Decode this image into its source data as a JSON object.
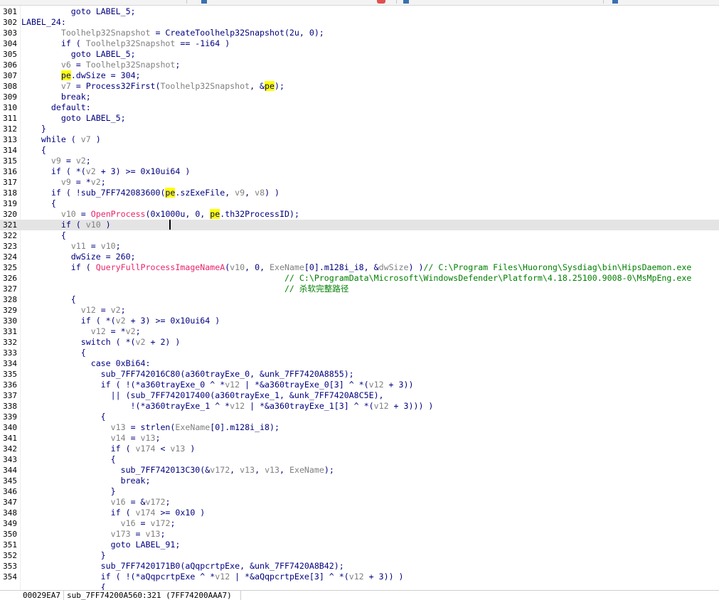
{
  "colors": {
    "text": "#000080",
    "variable": "#808080",
    "function": "#e8246b",
    "comment": "#008000",
    "highlight": "#ffff00",
    "current_line": "#e4e4e4"
  },
  "editor": {
    "current_line_number": "321",
    "lines": [
      {
        "n": "301",
        "segs": [
          [
            "t",
            "          goto LABEL_5;"
          ]
        ]
      },
      {
        "n": "302",
        "segs": [
          [
            "t",
            "LABEL_24:"
          ]
        ]
      },
      {
        "n": "303",
        "segs": [
          [
            "t",
            "        "
          ],
          [
            "v",
            "Toolhelp32Snapshot"
          ],
          [
            "t",
            " = CreateToolhelp32Snapshot(2u, 0);"
          ]
        ]
      },
      {
        "n": "304",
        "segs": [
          [
            "t",
            "        if ( "
          ],
          [
            "v",
            "Toolhelp32Snapshot"
          ],
          [
            "t",
            " == -1i64 )"
          ]
        ]
      },
      {
        "n": "305",
        "segs": [
          [
            "t",
            "          goto LABEL_5;"
          ]
        ]
      },
      {
        "n": "306",
        "segs": [
          [
            "t",
            "        "
          ],
          [
            "v",
            "v6"
          ],
          [
            "t",
            " = "
          ],
          [
            "v",
            "Toolhelp32Snapshot"
          ],
          [
            "t",
            ";"
          ]
        ]
      },
      {
        "n": "307",
        "segs": [
          [
            "t",
            "        "
          ],
          [
            "h",
            "pe"
          ],
          [
            "t",
            ".dwSize = 304;"
          ]
        ]
      },
      {
        "n": "308",
        "segs": [
          [
            "t",
            "        "
          ],
          [
            "v",
            "v7"
          ],
          [
            "t",
            " = Process32First("
          ],
          [
            "v",
            "Toolhelp32Snapshot"
          ],
          [
            "t",
            ", &"
          ],
          [
            "h",
            "pe"
          ],
          [
            "t",
            ");"
          ]
        ]
      },
      {
        "n": "309",
        "segs": [
          [
            "t",
            "        break;"
          ]
        ]
      },
      {
        "n": "310",
        "segs": [
          [
            "t",
            "      default:"
          ]
        ]
      },
      {
        "n": "311",
        "segs": [
          [
            "t",
            "        goto LABEL_5;"
          ]
        ]
      },
      {
        "n": "312",
        "segs": [
          [
            "t",
            "    }"
          ]
        ]
      },
      {
        "n": "313",
        "segs": [
          [
            "t",
            "    while ( "
          ],
          [
            "v",
            "v7"
          ],
          [
            "t",
            " )"
          ]
        ]
      },
      {
        "n": "314",
        "segs": [
          [
            "t",
            "    {"
          ]
        ]
      },
      {
        "n": "315",
        "segs": [
          [
            "t",
            "      "
          ],
          [
            "v",
            "v9"
          ],
          [
            "t",
            " = "
          ],
          [
            "v",
            "v2"
          ],
          [
            "t",
            ";"
          ]
        ]
      },
      {
        "n": "316",
        "segs": [
          [
            "t",
            "      if ( *("
          ],
          [
            "v",
            "v2"
          ],
          [
            "t",
            " + 3) >= 0x10ui64 )"
          ]
        ]
      },
      {
        "n": "317",
        "segs": [
          [
            "t",
            "        "
          ],
          [
            "v",
            "v9"
          ],
          [
            "t",
            " = *"
          ],
          [
            "v",
            "v2"
          ],
          [
            "t",
            ";"
          ]
        ]
      },
      {
        "n": "318",
        "segs": [
          [
            "t",
            "      if ( !sub_7FF742083600("
          ],
          [
            "h",
            "pe"
          ],
          [
            "t",
            ".szExeFile, "
          ],
          [
            "v",
            "v9"
          ],
          [
            "t",
            ", "
          ],
          [
            "v",
            "v8"
          ],
          [
            "t",
            ") )"
          ]
        ]
      },
      {
        "n": "319",
        "segs": [
          [
            "t",
            "      {"
          ]
        ]
      },
      {
        "n": "320",
        "segs": [
          [
            "t",
            "        "
          ],
          [
            "v",
            "v10"
          ],
          [
            "t",
            " = "
          ],
          [
            "f",
            "OpenProcess"
          ],
          [
            "t",
            "(0x1000u, 0, "
          ],
          [
            "h",
            "pe"
          ],
          [
            "t",
            ".th32ProcessID);"
          ]
        ]
      },
      {
        "n": "321",
        "segs": [
          [
            "t",
            "        if ( "
          ],
          [
            "v",
            "v10"
          ],
          [
            "t",
            " )"
          ]
        ]
      },
      {
        "n": "322",
        "segs": [
          [
            "t",
            "        {"
          ]
        ]
      },
      {
        "n": "323",
        "segs": [
          [
            "t",
            "          "
          ],
          [
            "v",
            "v11"
          ],
          [
            "t",
            " = "
          ],
          [
            "v",
            "v10"
          ],
          [
            "t",
            ";"
          ]
        ]
      },
      {
        "n": "324",
        "segs": [
          [
            "t",
            "          dwSize = 260;"
          ]
        ]
      },
      {
        "n": "325",
        "segs": [
          [
            "t",
            "          if ( "
          ],
          [
            "f",
            "QueryFullProcessImageNameA"
          ],
          [
            "t",
            "("
          ],
          [
            "v",
            "v10"
          ],
          [
            "t",
            ", 0, "
          ],
          [
            "v",
            "ExeName"
          ],
          [
            "t",
            "[0].m128i_i8, &"
          ],
          [
            "v",
            "dwSize"
          ],
          [
            "t",
            ") )"
          ],
          [
            "c",
            "// C:\\Program Files\\Huorong\\Sysdiag\\bin\\HipsDaemon.exe"
          ]
        ]
      },
      {
        "n": "326",
        "segs": [
          [
            "t",
            "                                                     "
          ],
          [
            "c",
            "// C:\\ProgramData\\Microsoft\\WindowsDefender\\Platform\\4.18.25100.9008-0\\MsMpEng.exe"
          ]
        ]
      },
      {
        "n": "327",
        "segs": [
          [
            "t",
            "                                                     "
          ],
          [
            "c",
            "// 杀软完整路径"
          ]
        ]
      },
      {
        "n": "328",
        "segs": [
          [
            "t",
            "          {"
          ]
        ]
      },
      {
        "n": "329",
        "segs": [
          [
            "t",
            "            "
          ],
          [
            "v",
            "v12"
          ],
          [
            "t",
            " = "
          ],
          [
            "v",
            "v2"
          ],
          [
            "t",
            ";"
          ]
        ]
      },
      {
        "n": "330",
        "segs": [
          [
            "t",
            "            if ( *("
          ],
          [
            "v",
            "v2"
          ],
          [
            "t",
            " + 3) >= 0x10ui64 )"
          ]
        ]
      },
      {
        "n": "331",
        "segs": [
          [
            "t",
            "              "
          ],
          [
            "v",
            "v12"
          ],
          [
            "t",
            " = *"
          ],
          [
            "v",
            "v2"
          ],
          [
            "t",
            ";"
          ]
        ]
      },
      {
        "n": "332",
        "segs": [
          [
            "t",
            "            switch ( *("
          ],
          [
            "v",
            "v2"
          ],
          [
            "t",
            " + 2) )"
          ]
        ]
      },
      {
        "n": "333",
        "segs": [
          [
            "t",
            "            {"
          ]
        ]
      },
      {
        "n": "334",
        "segs": [
          [
            "t",
            "              case 0xBi64:"
          ]
        ]
      },
      {
        "n": "335",
        "segs": [
          [
            "t",
            "                sub_7FF742016C80(a360trayExe_0, &unk_7FF7420A8855);"
          ]
        ]
      },
      {
        "n": "336",
        "segs": [
          [
            "t",
            "                if ( !(*a360trayExe_0 ^ *"
          ],
          [
            "v",
            "v12"
          ],
          [
            "t",
            " | *&a360trayExe_0[3] ^ *("
          ],
          [
            "v",
            "v12"
          ],
          [
            "t",
            " + 3))"
          ]
        ]
      },
      {
        "n": "337",
        "segs": [
          [
            "t",
            "                  || (sub_7FF742017400(a360trayExe_1, &unk_7FF7420A8C5E),"
          ]
        ]
      },
      {
        "n": "338",
        "segs": [
          [
            "t",
            "                      !(*a360trayExe_1 ^ *"
          ],
          [
            "v",
            "v12"
          ],
          [
            "t",
            " | *&a360trayExe_1[3] ^ *("
          ],
          [
            "v",
            "v12"
          ],
          [
            "t",
            " + 3))) )"
          ]
        ]
      },
      {
        "n": "339",
        "segs": [
          [
            "t",
            "                {"
          ]
        ]
      },
      {
        "n": "340",
        "segs": [
          [
            "t",
            "                  "
          ],
          [
            "v",
            "v13"
          ],
          [
            "t",
            " = strlen("
          ],
          [
            "v",
            "ExeName"
          ],
          [
            "t",
            "[0].m128i_i8);"
          ]
        ]
      },
      {
        "n": "341",
        "segs": [
          [
            "t",
            "                  "
          ],
          [
            "v",
            "v14"
          ],
          [
            "t",
            " = "
          ],
          [
            "v",
            "v13"
          ],
          [
            "t",
            ";"
          ]
        ]
      },
      {
        "n": "342",
        "segs": [
          [
            "t",
            "                  if ( "
          ],
          [
            "v",
            "v174"
          ],
          [
            "t",
            " < "
          ],
          [
            "v",
            "v13"
          ],
          [
            "t",
            " )"
          ]
        ]
      },
      {
        "n": "343",
        "segs": [
          [
            "t",
            "                  {"
          ]
        ]
      },
      {
        "n": "344",
        "segs": [
          [
            "t",
            "                    sub_7FF742013C30(&"
          ],
          [
            "v",
            "v172"
          ],
          [
            "t",
            ", "
          ],
          [
            "v",
            "v13"
          ],
          [
            "t",
            ", "
          ],
          [
            "v",
            "v13"
          ],
          [
            "t",
            ", "
          ],
          [
            "v",
            "ExeName"
          ],
          [
            "t",
            ");"
          ]
        ]
      },
      {
        "n": "345",
        "segs": [
          [
            "t",
            "                    break;"
          ]
        ]
      },
      {
        "n": "346",
        "segs": [
          [
            "t",
            "                  }"
          ]
        ]
      },
      {
        "n": "347",
        "segs": [
          [
            "t",
            "                  "
          ],
          [
            "v",
            "v16"
          ],
          [
            "t",
            " = &"
          ],
          [
            "v",
            "v172"
          ],
          [
            "t",
            ";"
          ]
        ]
      },
      {
        "n": "348",
        "segs": [
          [
            "t",
            "                  if ( "
          ],
          [
            "v",
            "v174"
          ],
          [
            "t",
            " >= 0x10 )"
          ]
        ]
      },
      {
        "n": "349",
        "segs": [
          [
            "t",
            "                    "
          ],
          [
            "v",
            "v16"
          ],
          [
            "t",
            " = "
          ],
          [
            "v",
            "v172"
          ],
          [
            "t",
            ";"
          ]
        ]
      },
      {
        "n": "350",
        "segs": [
          [
            "t",
            "                  "
          ],
          [
            "v",
            "v173"
          ],
          [
            "t",
            " = "
          ],
          [
            "v",
            "v13"
          ],
          [
            "t",
            ";"
          ]
        ]
      },
      {
        "n": "351",
        "segs": [
          [
            "t",
            "                  goto LABEL_91;"
          ]
        ]
      },
      {
        "n": "352",
        "segs": [
          [
            "t",
            "                }"
          ]
        ]
      },
      {
        "n": "353",
        "segs": [
          [
            "t",
            "                sub_7FF7420171B0(aQqpcrtpExe, &unk_7FF7420A8B42);"
          ]
        ]
      },
      {
        "n": "354",
        "segs": [
          [
            "t",
            "                if ( !(*aQqpcrtpExe ^ *"
          ],
          [
            "v",
            "v12"
          ],
          [
            "t",
            " | *&aQqpcrtpExe[3] ^ *("
          ],
          [
            "v",
            "v12"
          ],
          [
            "t",
            " + 3)) )"
          ]
        ]
      },
      {
        "n": "",
        "segs": [
          [
            "t",
            "                {"
          ]
        ]
      }
    ]
  },
  "status_bar": {
    "address": "00029EA7",
    "location": "sub_7FF74200A560:321 (7FF74200AAA7)"
  }
}
